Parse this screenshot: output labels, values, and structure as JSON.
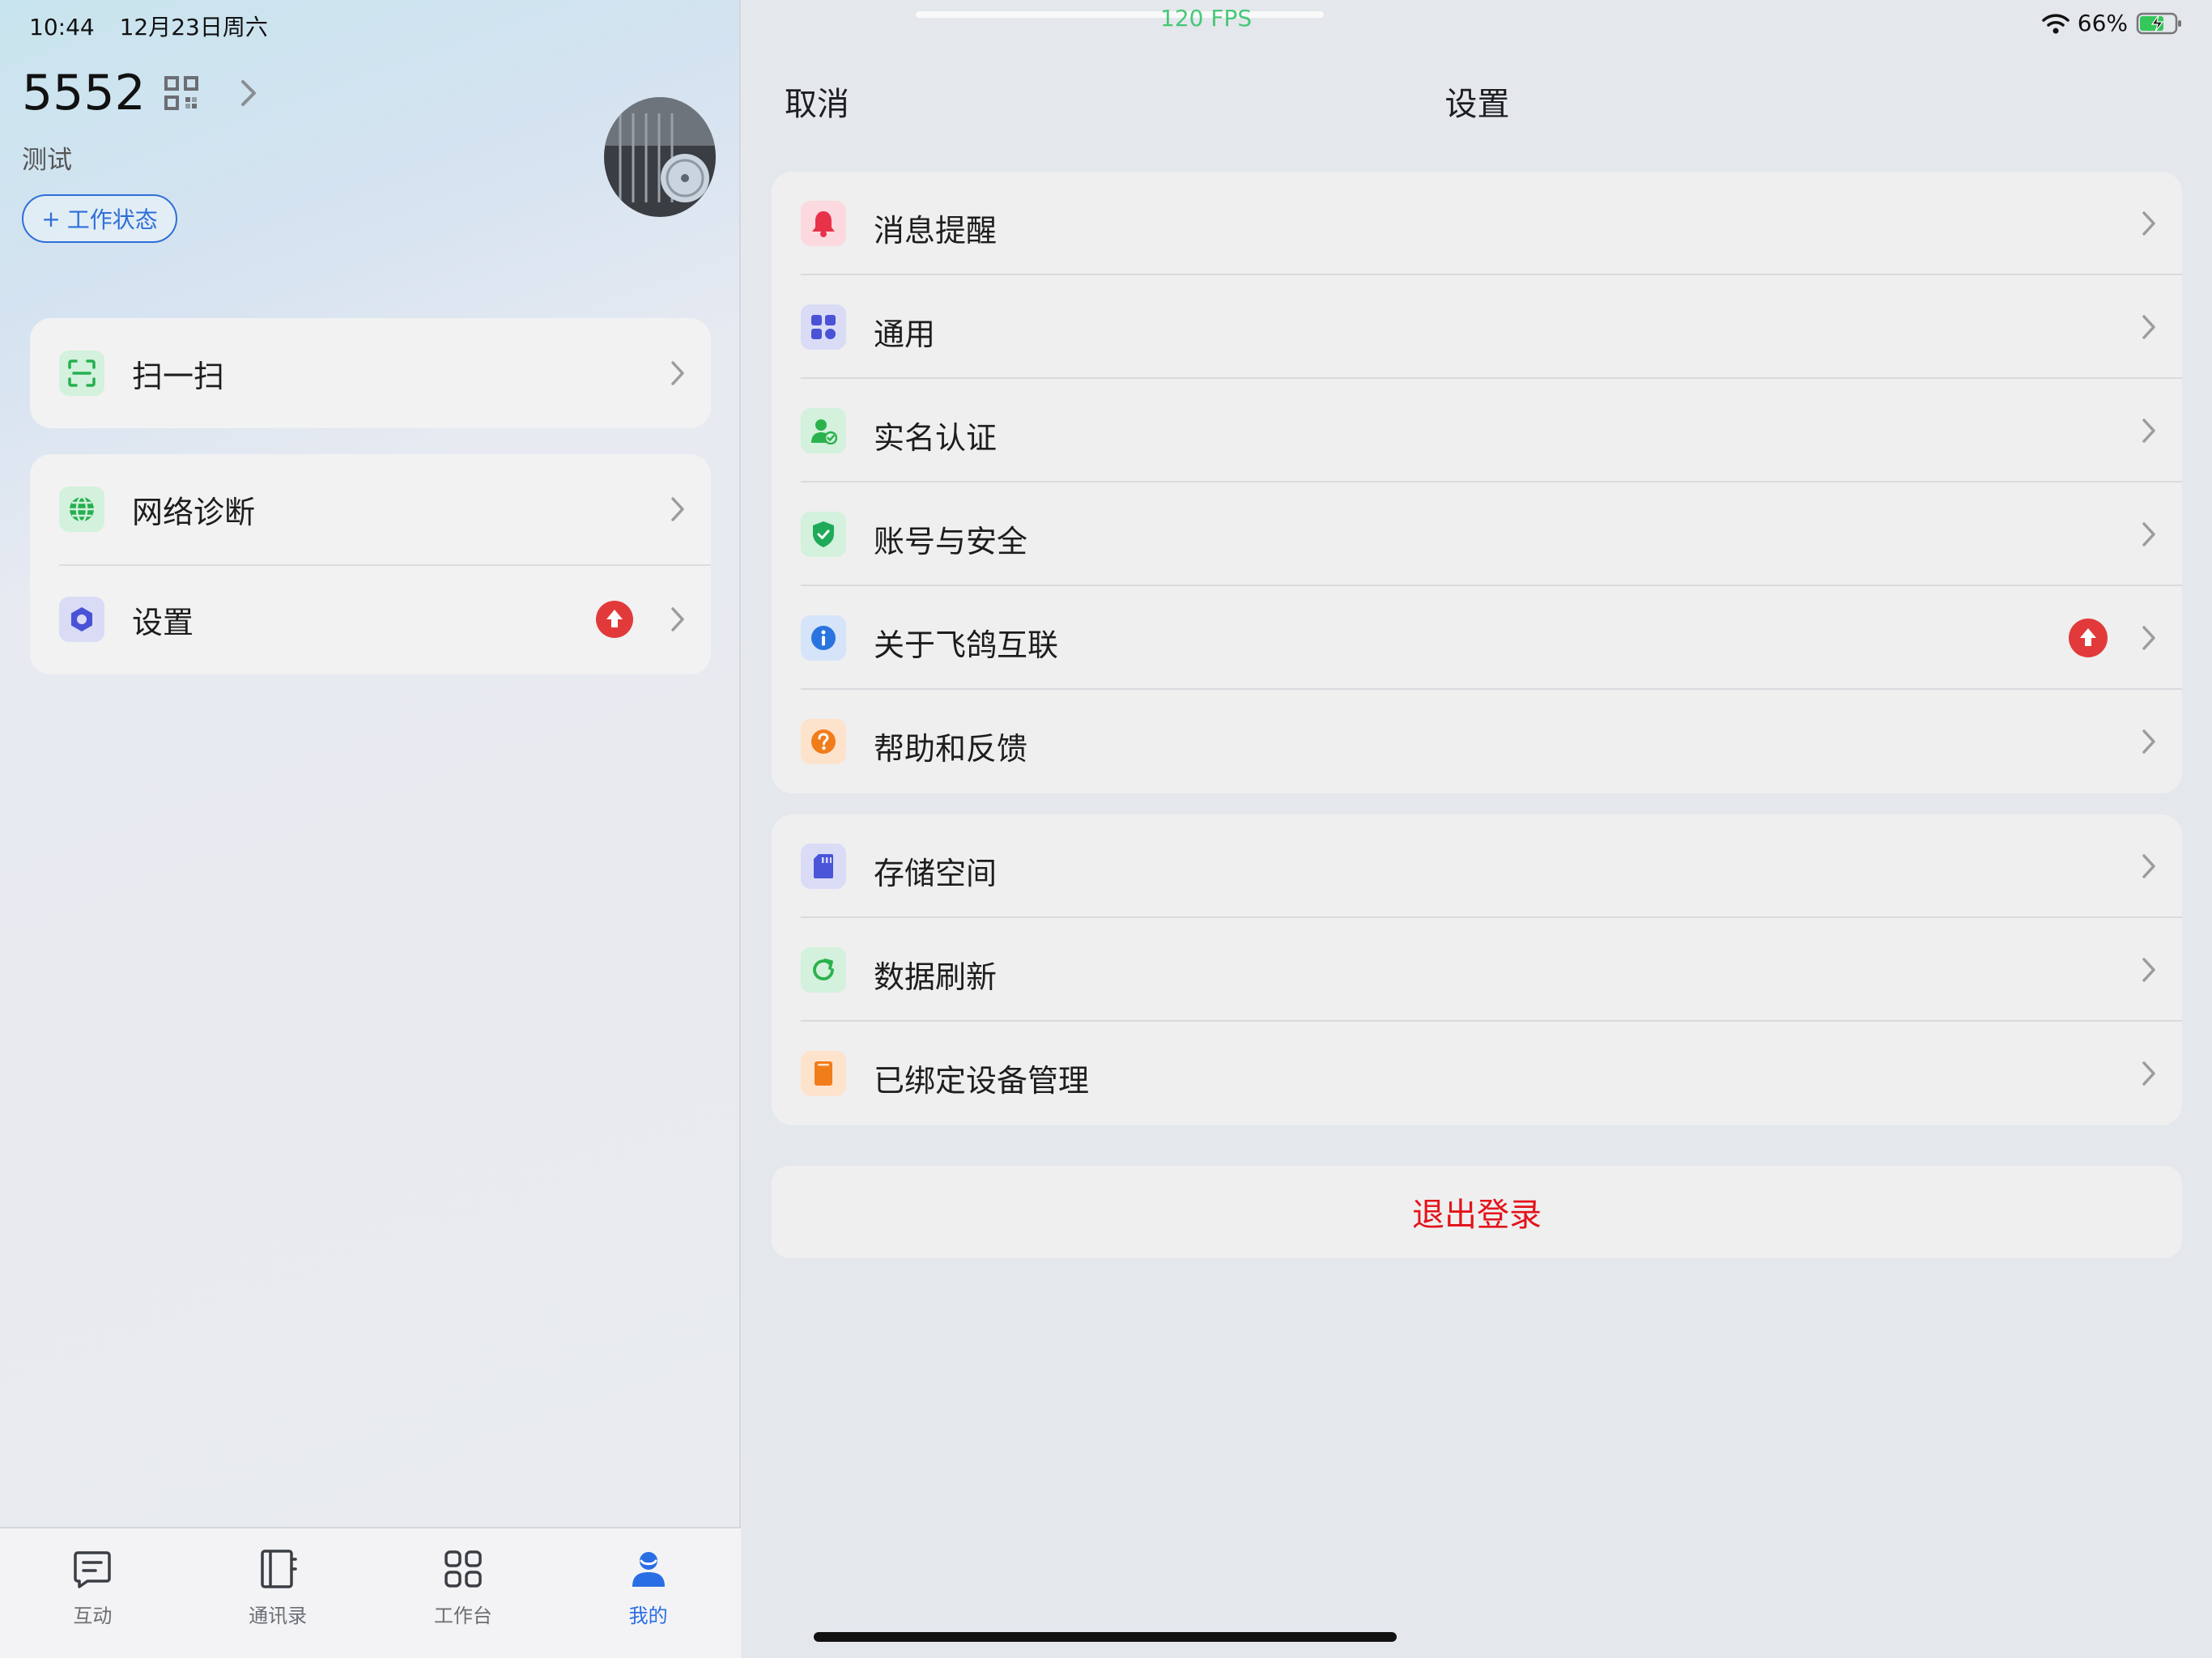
{
  "status": {
    "time": "10:44",
    "date": "12月23日周六",
    "battery": "66%",
    "fps": "120 FPS"
  },
  "profile": {
    "uid": "5552",
    "name": "测试",
    "work_status": "工作状态"
  },
  "left_menu": {
    "scan": "扫一扫",
    "network": "网络诊断",
    "settings": "设置"
  },
  "tabs": [
    {
      "label": "互动"
    },
    {
      "label": "通讯录"
    },
    {
      "label": "工作台"
    },
    {
      "label": "我的"
    }
  ],
  "settings_page": {
    "cancel": "取消",
    "title": "设置",
    "group1": [
      {
        "label": "消息提醒",
        "icon": "bell-icon",
        "color": "#e8324a"
      },
      {
        "label": "通用",
        "icon": "grid-icon",
        "color": "#4a52d6"
      },
      {
        "label": "实名认证",
        "icon": "user-check-icon",
        "color": "#2bb24c"
      },
      {
        "label": "账号与安全",
        "icon": "shield-icon",
        "color": "#1faa5a"
      },
      {
        "label": "关于飞鸽互联",
        "icon": "info-icon",
        "color": "#2a74e0",
        "badge": true
      },
      {
        "label": "帮助和反馈",
        "icon": "help-icon",
        "color": "#f07d1a"
      }
    ],
    "group2": [
      {
        "label": "存储空间",
        "icon": "sd-card-icon",
        "color": "#4b55d8"
      },
      {
        "label": "数据刷新",
        "icon": "refresh-icon",
        "color": "#2bb24c"
      },
      {
        "label": "已绑定设备管理",
        "icon": "device-icon",
        "color": "#f07d1a"
      }
    ],
    "logout": "退出登录"
  },
  "colors": {
    "accent": "#2a6ee6",
    "danger": "#e3141b",
    "badge": "#e23a3a"
  }
}
